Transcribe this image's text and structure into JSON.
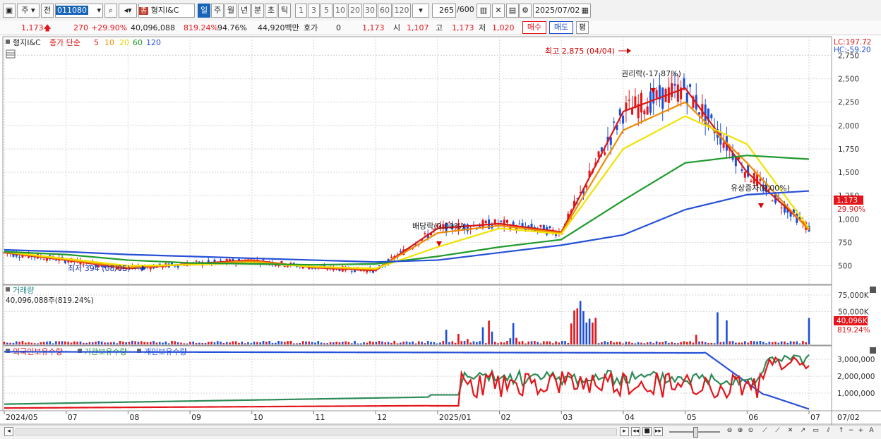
{
  "toolbar": {
    "market": "주",
    "range": "전",
    "code": "011080",
    "stock_name": "형지I&C",
    "stock_badge": "종",
    "periods": [
      "일",
      "주",
      "월",
      "년",
      "분",
      "초",
      "틱"
    ],
    "selected_period": "일",
    "intervals": [
      "1",
      "3",
      "5",
      "10",
      "20",
      "30",
      "60",
      "120"
    ],
    "count": "265",
    "max_count": "/600",
    "date": "2025/07/02"
  },
  "quote": {
    "price": "1,173",
    "change": "270",
    "change_pct": "+29.90%",
    "volume": "40,096,088",
    "volume_ratio": "819.24%",
    "ratio2": "94.76%",
    "amount": "44,920백만",
    "hoga_label": "호가",
    "hoga_value": "0",
    "hoga_price": "1,173",
    "open_label": "시",
    "open": "1,107",
    "high_label": "고",
    "high": "1,173",
    "low_label": "저",
    "low": "1,020",
    "buy": "매수",
    "sell": "매도",
    "avg": "평"
  },
  "price_panel": {
    "name": "형지I&C",
    "legend_prefix": "종가 단순",
    "ma": [
      {
        "label": "5",
        "color": "#d91616"
      },
      {
        "label": "10",
        "color": "#f08c00"
      },
      {
        "label": "20",
        "color": "#f2e200"
      },
      {
        "label": "60",
        "color": "#1f9a2c"
      },
      {
        "label": "120",
        "color": "#2650d8"
      }
    ],
    "lc": "LC:197.72",
    "hc": "HC:-59.20",
    "current_tag": "1,173",
    "current_pct_tag": "29.90%",
    "annotations": {
      "high": "최고 2,875 (04/04)",
      "low": "최저 394 (08/05)",
      "rights": "권리락(-17.87%)",
      "dividend": "배당락(0.00%)",
      "capital": "유상증자(0.00%)"
    }
  },
  "volume_panel": {
    "title": "거래량",
    "info": "40,096,088주(819.24%)",
    "current_tag": "40,096K",
    "current_pct_tag": "819.24%"
  },
  "holding_panel": {
    "legend": [
      "외국인보유수량",
      "기관보유수량",
      "개인보유수량"
    ]
  },
  "xaxis": [
    "2024/05",
    "07",
    "08",
    "09",
    "10",
    "11",
    "12",
    "2025/01",
    "02",
    "03",
    "04",
    "05",
    "06",
    "07"
  ],
  "xaxis_end": "07/02",
  "chart_data": [
    {
      "type": "line",
      "title": "형지I&C",
      "y_ticks": [
        500,
        750,
        1000,
        1250,
        1500,
        1750,
        2000,
        2250,
        2500,
        2750
      ],
      "ylim": [
        300,
        2950
      ],
      "x": [
        "2024/05",
        "07",
        "08",
        "09",
        "10",
        "11",
        "12",
        "2025/01",
        "02",
        "03",
        "04",
        "05",
        "06",
        "07"
      ],
      "series": [
        {
          "name": "5",
          "values": [
            640,
            560,
            470,
            520,
            560,
            480,
            450,
            900,
            950,
            860,
            2150,
            2400,
            1500,
            900
          ]
        },
        {
          "name": "10",
          "values": [
            645,
            565,
            480,
            515,
            550,
            485,
            460,
            850,
            930,
            850,
            1950,
            2250,
            1600,
            880
          ]
        },
        {
          "name": "20",
          "values": [
            650,
            575,
            500,
            510,
            530,
            490,
            470,
            700,
            900,
            840,
            1750,
            2100,
            1800,
            900
          ]
        },
        {
          "name": "60",
          "values": [
            650,
            620,
            560,
            530,
            520,
            510,
            520,
            600,
            700,
            780,
            1200,
            1600,
            1680,
            1640
          ]
        },
        {
          "name": "120",
          "values": [
            670,
            650,
            620,
            600,
            580,
            560,
            540,
            560,
            640,
            720,
            830,
            1100,
            1260,
            1300
          ]
        }
      ]
    },
    {
      "type": "bar",
      "title": "거래량",
      "y_ticks": [
        "50,000K",
        "75,000K"
      ],
      "ylim": [
        0,
        90000
      ]
    },
    {
      "type": "line",
      "legend": [
        "외국인보유수량",
        "기관보유수량",
        "개인보유수량"
      ],
      "y_ticks": [
        "1,000,000",
        "2,000,000",
        "3,000,000"
      ],
      "ylim": [
        0,
        3800000
      ]
    }
  ]
}
